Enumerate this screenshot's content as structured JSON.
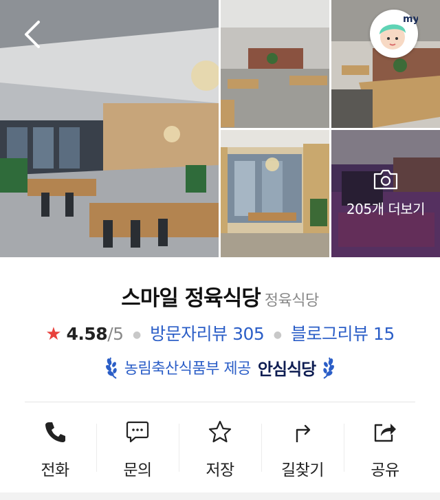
{
  "gallery": {
    "more_label": "205개 더보기"
  },
  "place": {
    "name": "스마일 정육식당",
    "category": "정육식당"
  },
  "rating": {
    "star": "★",
    "score": "4.58",
    "max": "/5",
    "visitor_reviews": "방문자리뷰 305",
    "blog_reviews": "블로그리뷰 15"
  },
  "badge": {
    "provider": "농림축산식품부 제공",
    "title": "안심식당"
  },
  "actions": [
    {
      "label": "전화",
      "icon": "phone-icon"
    },
    {
      "label": "문의",
      "icon": "chat-icon"
    },
    {
      "label": "저장",
      "icon": "star-icon"
    },
    {
      "label": "길찾기",
      "icon": "directions-icon"
    },
    {
      "label": "공유",
      "icon": "share-icon"
    }
  ],
  "colors": {
    "accent": "#2b5ec7",
    "star": "#e8413c",
    "badge_dark": "#0e1d52"
  }
}
